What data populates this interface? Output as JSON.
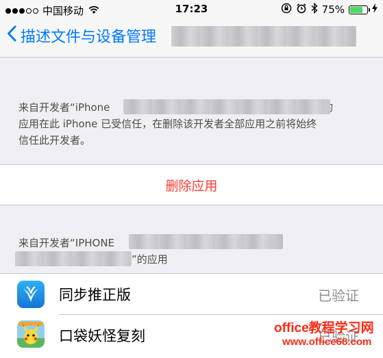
{
  "status_bar": {
    "carrier": "中国移动",
    "time": "17:23",
    "battery": "75%",
    "battery_level": 0.75
  },
  "nav": {
    "back_label": "描述文件与设备管理"
  },
  "trusted_section": {
    "line1_prefix": "来自开发者“iPhone",
    "line1_suffix": "”的",
    "line2": "应用在此 iPhone 已受信任，在删除该开发者全部应用之前将始终",
    "line3": "信任此开发者。"
  },
  "delete_button": {
    "label": "删除应用"
  },
  "apps_section": {
    "header_prefix": "来自开发者“IPHONE",
    "header_suffix": "”的应用"
  },
  "apps": [
    {
      "name": "同步推正版",
      "status": "已验证",
      "icon": "tongbutui-app-icon"
    },
    {
      "name": "口袋妖怪复刻",
      "status": "已验证",
      "icon": "pokemon-app-icon"
    }
  ],
  "watermark": {
    "line1": "office教程学习网",
    "line2": "www.office68.com"
  },
  "colors": {
    "accent": "#007aff",
    "destructive": "#ff3b30",
    "background": "#efeff4",
    "watermark": "#ff2b14"
  }
}
